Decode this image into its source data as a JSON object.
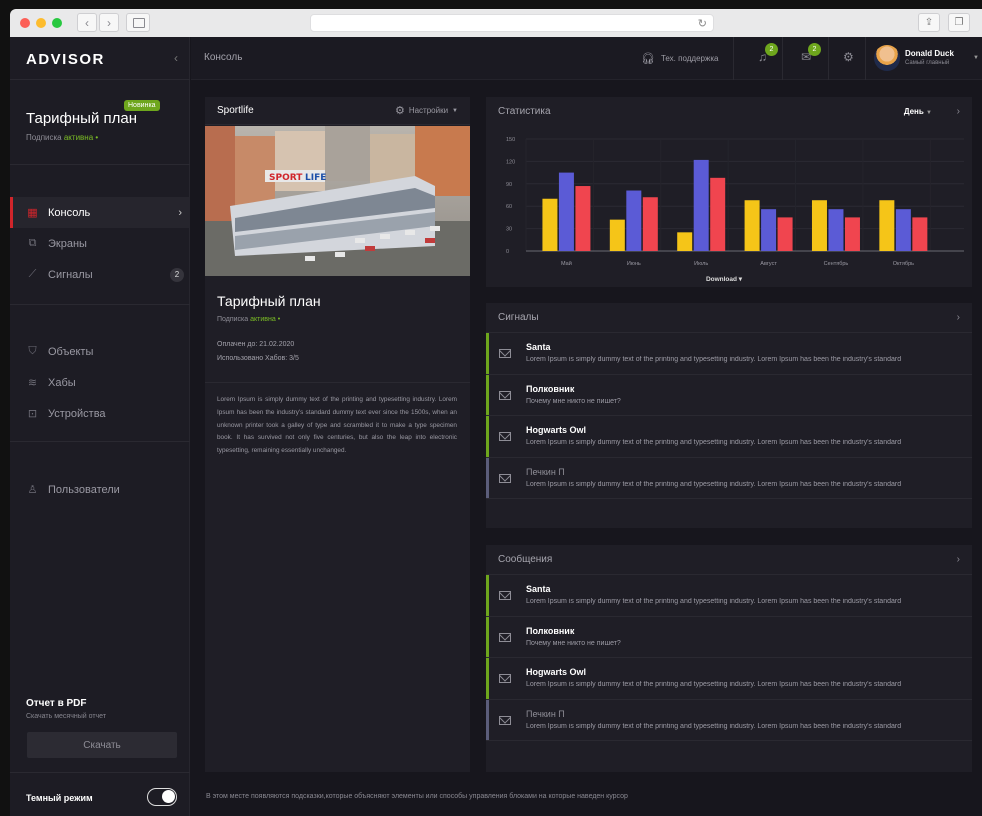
{
  "app": {
    "logo": "ADVISOR",
    "breadcrumb": "Консоль"
  },
  "topbar": {
    "support": "Тех. поддержка",
    "notifications_count": "2",
    "mail_count": "2",
    "user_name": "Donald Duck",
    "user_role": "Самый главный"
  },
  "sidebar": {
    "plan_title": "Тарифный план",
    "plan_badge": "Новинка",
    "plan_sub_prefix": "Подписка",
    "plan_sub_status": "активна",
    "items": [
      {
        "label": "Консоль",
        "icon": "dashboard-icon"
      },
      {
        "label": "Экраны",
        "icon": "screens-icon"
      },
      {
        "label": "Сигналы",
        "icon": "signals-icon",
        "count": "2"
      },
      {
        "label": "Объекты",
        "icon": "shield-icon"
      },
      {
        "label": "Хабы",
        "icon": "wifi-icon"
      },
      {
        "label": "Устройства",
        "icon": "inbox-icon"
      },
      {
        "label": "Пользователи",
        "icon": "user-icon"
      }
    ],
    "pdf_title": "Отчет в PDF",
    "pdf_sub": "Скачать месячный отчет",
    "download_button": "Скачать",
    "dark_mode_label": "Темный режим"
  },
  "object_card": {
    "header_title": "Sportlife",
    "settings_label": "Настройки",
    "title": "Тарифный план",
    "sub_prefix": "Подписка",
    "sub_status": "активна",
    "paid_until": "Оплачен до: 21.02.2020",
    "hubs_used": "Использовано Хабов: 3/5",
    "description": "Lorem Ipsum is simply dummy text of the printing and typesetting industry. Lorem Ipsum has been the industry's standard dummy text ever since the 1500s, when an unknown printer took a galley of type and scrambled it to make a type specimen book. It has survived not only five centuries, but also the leap into electronic typesetting, remaining essentially unchanged."
  },
  "stats": {
    "title": "Статистика",
    "period": "День",
    "download_label": "Download"
  },
  "chart_data": {
    "type": "bar",
    "categories": [
      "Май",
      "Июнь",
      "Июль",
      "Август",
      "Сентябрь",
      "Октябрь"
    ],
    "series": [
      {
        "values": [
          70,
          42,
          25,
          68,
          68,
          68
        ],
        "color": "#f5c518"
      },
      {
        "values": [
          105,
          81,
          122,
          56,
          56,
          56
        ],
        "color": "#5b5bd6"
      },
      {
        "values": [
          87,
          72,
          98,
          45,
          45,
          45
        ],
        "color": "#f0454f"
      }
    ],
    "ylim": [
      0,
      150
    ],
    "yticks": [
      0,
      30,
      60,
      90,
      120,
      150
    ],
    "grid": true
  },
  "signals": {
    "title": "Сигналы",
    "items": [
      {
        "from": "Santa",
        "text": "Lorem Ipsum is simply dummy text of the printing and typesetting industry. Lorem Ipsum has been the industry's standard",
        "accent": "#6ea61d",
        "muted": false
      },
      {
        "from": "Полковник",
        "text": "Почему мне никто не пишет?",
        "accent": "#6ea61d",
        "muted": false
      },
      {
        "from": "Hogwarts Owl",
        "text": "Lorem Ipsum is simply dummy text of the printing and typesetting industry. Lorem Ipsum has been the industry's standard",
        "accent": "#6ea61d",
        "muted": false
      },
      {
        "from": "Печкин П",
        "text": "Lorem Ipsum is simply dummy text of the printing and typesetting industry. Lorem Ipsum has been the industry's standard",
        "accent": "#5b5d7a",
        "muted": true
      }
    ]
  },
  "messages": {
    "title": "Сообщения",
    "items": [
      {
        "from": "Santa",
        "text": "Lorem Ipsum is simply dummy text of the printing and typesetting industry. Lorem Ipsum has been the industry's standard",
        "accent": "#6ea61d",
        "muted": false
      },
      {
        "from": "Полковник",
        "text": "Почему мне никто не пишет?",
        "accent": "#6ea61d",
        "muted": false
      },
      {
        "from": "Hogwarts Owl",
        "text": "Lorem Ipsum is simply dummy text of the printing and typesetting industry. Lorem Ipsum has been the industry's standard",
        "accent": "#6ea61d",
        "muted": false
      },
      {
        "from": "Печкин П",
        "text": "Lorem Ipsum is simply dummy text of the printing and typesetting industry. Lorem Ipsum has been the industry's standard",
        "accent": "#5b5d7a",
        "muted": true
      }
    ]
  },
  "footer_hint": "В этом месте появляются подсказки,которые объясняют элементы или способы управления блоками на которые наведен курсор"
}
